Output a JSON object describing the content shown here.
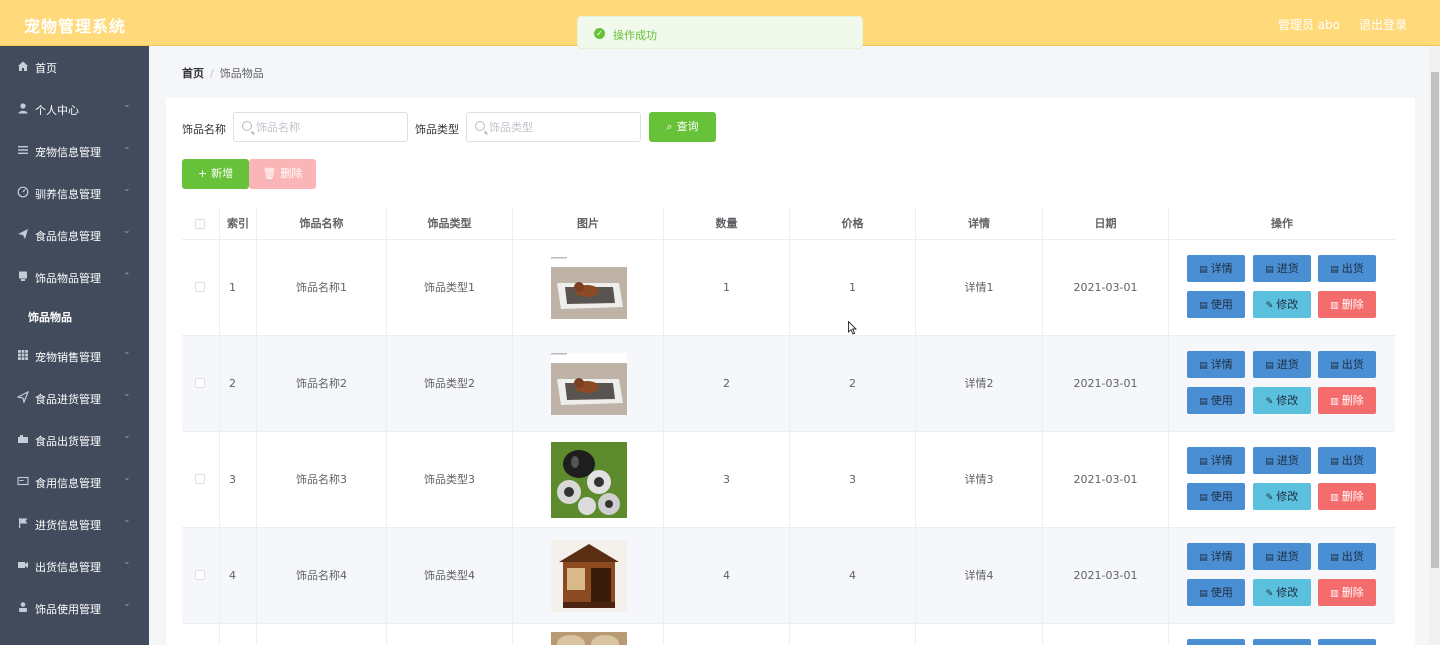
{
  "header": {
    "title": "宠物管理系统",
    "admin": "管理员 abo",
    "logout": "退出登录",
    "bg_color": "#ffd97a"
  },
  "toast": {
    "message": "操作成功",
    "type": "success"
  },
  "sidebar": {
    "items": [
      {
        "label": "首页",
        "icon": "home-icon",
        "expandable": false
      },
      {
        "label": "个人中心",
        "icon": "user-icon",
        "expandable": true
      },
      {
        "label": "宠物信息管理",
        "icon": "list-icon",
        "expandable": true
      },
      {
        "label": "驯养信息管理",
        "icon": "compass-icon",
        "expandable": true
      },
      {
        "label": "食品信息管理",
        "icon": "send-icon",
        "expandable": true
      },
      {
        "label": "饰品物品管理",
        "icon": "box-icon",
        "expandable": true,
        "expanded": true
      },
      {
        "label": "宠物销售管理",
        "icon": "grid-icon",
        "expandable": true
      },
      {
        "label": "食品进货管理",
        "icon": "arrow-icon",
        "expandable": true
      },
      {
        "label": "食品出货管理",
        "icon": "truck-icon",
        "expandable": true
      },
      {
        "label": "食用信息管理",
        "icon": "card-icon",
        "expandable": true
      },
      {
        "label": "进货信息管理",
        "icon": "flag-icon",
        "expandable": true
      },
      {
        "label": "出货信息管理",
        "icon": "camera-icon",
        "expandable": true
      },
      {
        "label": "饰品使用管理",
        "icon": "person-icon",
        "expandable": true
      }
    ],
    "submenu_active": "饰品物品"
  },
  "breadcrumb": {
    "home": "首页",
    "separator": "/",
    "current": "饰品物品"
  },
  "filters": {
    "name_label": "饰品名称",
    "name_placeholder": "饰品名称",
    "type_label": "饰品类型",
    "type_placeholder": "饰品类型",
    "search_button": "查询"
  },
  "actions": {
    "add": "新增",
    "delete": "删除"
  },
  "table": {
    "columns": [
      "索引",
      "饰品名称",
      "饰品类型",
      "图片",
      "数量",
      "价格",
      "详情",
      "日期",
      "操作"
    ],
    "rows": [
      {
        "index": "1",
        "name": "饰品名称1",
        "type": "饰品类型1",
        "image": "dog-bed",
        "qty": "1",
        "price": "1",
        "detail": "详情1",
        "date": "2021-03-01"
      },
      {
        "index": "2",
        "name": "饰品名称2",
        "type": "饰品类型2",
        "image": "dog-bed",
        "qty": "2",
        "price": "2",
        "detail": "详情2",
        "date": "2021-03-01"
      },
      {
        "index": "3",
        "name": "饰品名称3",
        "type": "饰品类型3",
        "image": "pet-toys",
        "qty": "3",
        "price": "3",
        "detail": "详情3",
        "date": "2021-03-01"
      },
      {
        "index": "4",
        "name": "饰品名称4",
        "type": "饰品类型4",
        "image": "wooden-house",
        "qty": "4",
        "price": "4",
        "detail": "详情4",
        "date": "2021-03-01"
      }
    ],
    "ops": {
      "detail": "详情",
      "stock_in": "进货",
      "stock_out": "出货",
      "use": "使用",
      "edit": "修改",
      "delete": "删除"
    }
  }
}
